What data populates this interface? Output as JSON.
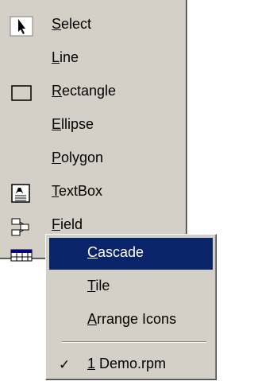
{
  "toolbox": {
    "items": [
      {
        "label": "Select",
        "icon": "arrow-pointer-icon"
      },
      {
        "label": "Line",
        "icon": ""
      },
      {
        "label": "Rectangle",
        "icon": "rectangle-icon"
      },
      {
        "label": "Ellipse",
        "icon": ""
      },
      {
        "label": "Polygon",
        "icon": ""
      },
      {
        "label": "TextBox",
        "icon": "textbox-icon"
      },
      {
        "label": "Field",
        "icon": "field-icon"
      }
    ]
  },
  "window_menu": {
    "items": [
      {
        "label": "Cascade",
        "highlighted": true
      },
      {
        "label": "Tile"
      },
      {
        "label": "Arrange Icons"
      }
    ],
    "windows": [
      {
        "label": "1 Demo.rpm",
        "checked": true
      }
    ],
    "check_glyph": "✓"
  },
  "colors": {
    "menu_bg": "#d4d0c8",
    "highlight": "#0a246a",
    "highlight_text": "#ffffff"
  }
}
